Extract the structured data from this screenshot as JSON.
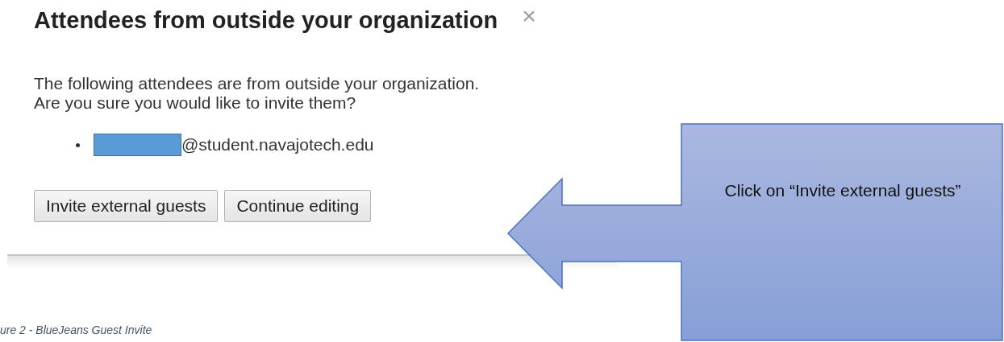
{
  "dialog": {
    "title": "Attendees from outside your organization",
    "close": "×",
    "message": [
      "The following attendees are from outside your organization.",
      "Are you sure you would like to invite them?"
    ],
    "attendees": [
      {
        "redacted": true,
        "email": "@student.navajotech.edu"
      }
    ],
    "buttons": [
      "Invite external guests",
      "Continue editing"
    ]
  },
  "callout": {
    "text": "Click on “Invite external guests”"
  },
  "caption": "ure 2 - BlueJeans Guest Invite"
}
